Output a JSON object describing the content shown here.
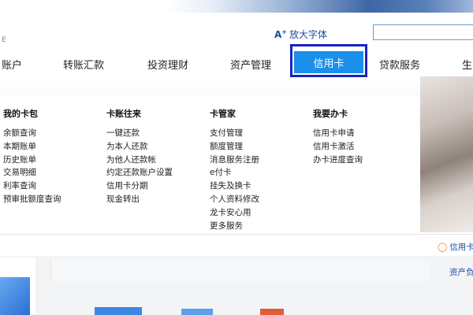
{
  "header": {
    "left_glyph": "E",
    "enlarge_font_label": "放大字体",
    "enlarge_font_icon": "font-size-increase-icon"
  },
  "nav": {
    "items": [
      {
        "label": "账户"
      },
      {
        "label": "转账汇款"
      },
      {
        "label": "投资理财"
      },
      {
        "label": "资产管理"
      },
      {
        "label": "信用卡",
        "active": true
      },
      {
        "label": "贷款服务"
      },
      {
        "label": "生"
      }
    ]
  },
  "menu": {
    "columns": [
      {
        "title": "我的卡包",
        "items": [
          "余额查询",
          "本期账单",
          "历史账单",
          "交易明细",
          "利率查询",
          "预审批额度查询"
        ]
      },
      {
        "title": "卡账往来",
        "items": [
          "一键还款",
          "为本人还款",
          "为他人还款帐",
          "约定还款账户设置",
          "信用卡分期",
          "现金转出"
        ]
      },
      {
        "title": "卡管家",
        "items": [
          "支付管理",
          "额度管理",
          "消息服务注册",
          "e付卡",
          "挂失及换卡",
          "个人资料修改",
          "龙卡安心用",
          "更多服务"
        ]
      },
      {
        "title": "我要办卡",
        "items": [
          "信用卡申请",
          "信用卡激活",
          "办卡进度查询"
        ]
      }
    ]
  },
  "footer": {
    "help_link": "信用卡",
    "help_icon": "lightbulb-icon",
    "asset_link": "资产负"
  },
  "colors": {
    "active_tab": "#1a90ea",
    "highlight_border": "#1b21c6",
    "link": "#1a4fa0"
  }
}
